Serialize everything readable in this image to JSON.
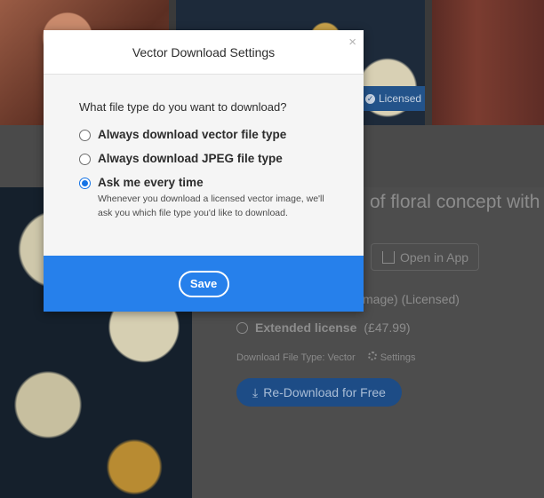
{
  "background": {
    "licensed_badge": "Licensed",
    "asset_title_fragment": "of floral concept with v",
    "open_in_app": "Open in App",
    "standard_license_fragment": "mage) (Licensed)",
    "extended_license_label": "Extended license",
    "extended_license_price": "(£47.99)",
    "download_file_type": "Download File Type: Vector",
    "settings_label": "Settings",
    "redownload_button": "Re-Download for Free"
  },
  "modal": {
    "title": "Vector Download Settings",
    "close_glyph": "×",
    "question": "What file type do you want to download?",
    "options": [
      {
        "label": "Always download vector file type",
        "selected": false
      },
      {
        "label": "Always download JPEG file type",
        "selected": false
      },
      {
        "label": "Ask me every time",
        "selected": true,
        "description": "Whenever you download a licensed vector image, we'll ask you which file type you'd like to download."
      }
    ],
    "save_label": "Save"
  },
  "colors": {
    "accent": "#2680eb",
    "radio_selected": "#1473e6"
  }
}
